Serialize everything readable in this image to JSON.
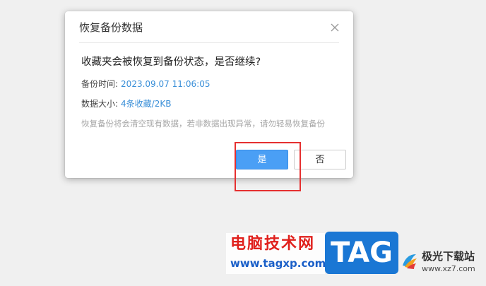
{
  "dialog": {
    "title": "恢复备份数据",
    "question": "收藏夹会被恢复到备份状态，是否继续?",
    "backup_time_label": "备份时间:",
    "backup_time_value": "2023.09.07 11:06:05",
    "data_size_label": "数据大小:",
    "data_size_value": "4条收藏/2KB",
    "warning": "恢复备份将会清空现有数据，若非数据出现异常，请勿轻易恢复备份",
    "yes_label": "是",
    "no_label": "否",
    "accent_color": "#4a9ff5",
    "link_color": "#3a8fd8",
    "highlight_color": "#e53030"
  },
  "watermark": {
    "site_title": "电脑技术网",
    "site_url": "www.tagxp.com",
    "tag_text": "TAG",
    "brand_name": "极光下载站",
    "brand_url": "www.xz7.com"
  },
  "icons": {
    "close": "close-icon",
    "brand_logo": "aurora-logo-icon"
  }
}
